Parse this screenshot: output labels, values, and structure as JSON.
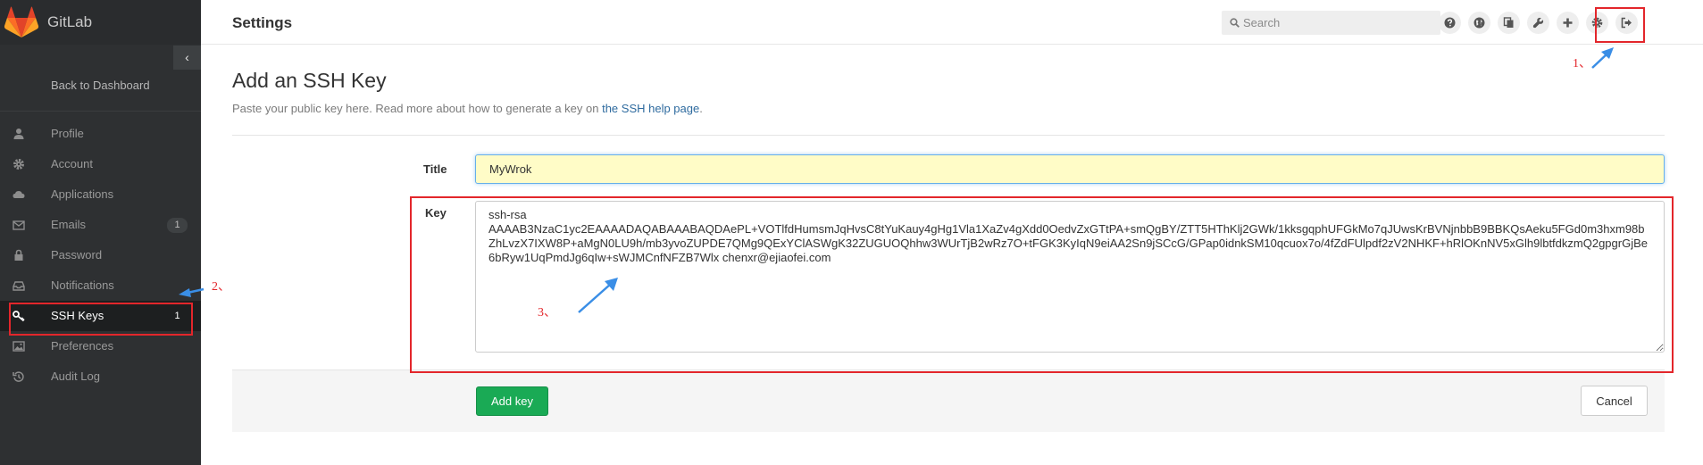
{
  "app": {
    "name": "GitLab"
  },
  "colors": {
    "sidebar": "#2e3032",
    "accent_button": "#1aaa55",
    "annotation": "#e3262b",
    "link": "#2f6b9f"
  },
  "sidebar": {
    "collapse_icon": "chevron-left-icon",
    "back_label": "Back to Dashboard",
    "items": [
      {
        "label": "Profile",
        "icon": "user-icon",
        "badge": ""
      },
      {
        "label": "Account",
        "icon": "gear-icon",
        "badge": ""
      },
      {
        "label": "Applications",
        "icon": "cloud-icon",
        "badge": ""
      },
      {
        "label": "Emails",
        "icon": "envelope-icon",
        "badge": "1"
      },
      {
        "label": "Password",
        "icon": "lock-icon",
        "badge": ""
      },
      {
        "label": "Notifications",
        "icon": "inbox-icon",
        "badge": ""
      },
      {
        "label": "SSH Keys",
        "icon": "key-icon",
        "badge": "1",
        "active": true
      },
      {
        "label": "Preferences",
        "icon": "image-icon",
        "badge": ""
      },
      {
        "label": "Audit Log",
        "icon": "history-icon",
        "badge": ""
      }
    ]
  },
  "header": {
    "title": "Settings",
    "search_placeholder": "Search",
    "icons": [
      "question-icon",
      "globe-icon",
      "copy-icon",
      "wrench-icon",
      "plus-icon",
      "gear-icon",
      "sign-out-icon"
    ]
  },
  "main": {
    "title": "Add an SSH Key",
    "desc_prefix": "Paste your public key here. Read more about how to generate a key on ",
    "desc_link": "the SSH help page",
    "desc_suffix": ".",
    "title_label": "Title",
    "title_value": "MyWrok",
    "key_label": "Key",
    "key_value": "ssh-rsa\nAAAAB3NzaC1yc2EAAAADAQABAAABAQDAePL+VOTlfdHumsmJqHvsC8tYuKauy4gHg1Vla1XaZv4gXdd0OedvZxGTtPA+smQgBY/ZTT5HThKlj2GWk/1kksgqphUFGkMo7qJUwsKrBVNjnbbB9BBKQsAeku5FGd0m3hxm98bZhLvzX7IXW8P+aMgN0LU9h/mb3yvoZUPDE7QMg9QExYClASWgK32ZUGUOQhhw3WUrTjB2wRz7O+tFGK3KyIqN9eiAA2Sn9jSCcG/GPap0idnkSM10qcuox7o/4fZdFUlpdf2zV2NHKF+hRlOKnNV5xGlh9lbtfdkzmQ2gpgrGjBe6bRyw1UqPmdJg6qIw+sWJMCnfNFZB7Wlx chenxr@ejiaofei.com",
    "add_button": "Add key",
    "cancel_button": "Cancel"
  },
  "annotations": {
    "one": "1、",
    "two": "2、",
    "three": "3、"
  }
}
